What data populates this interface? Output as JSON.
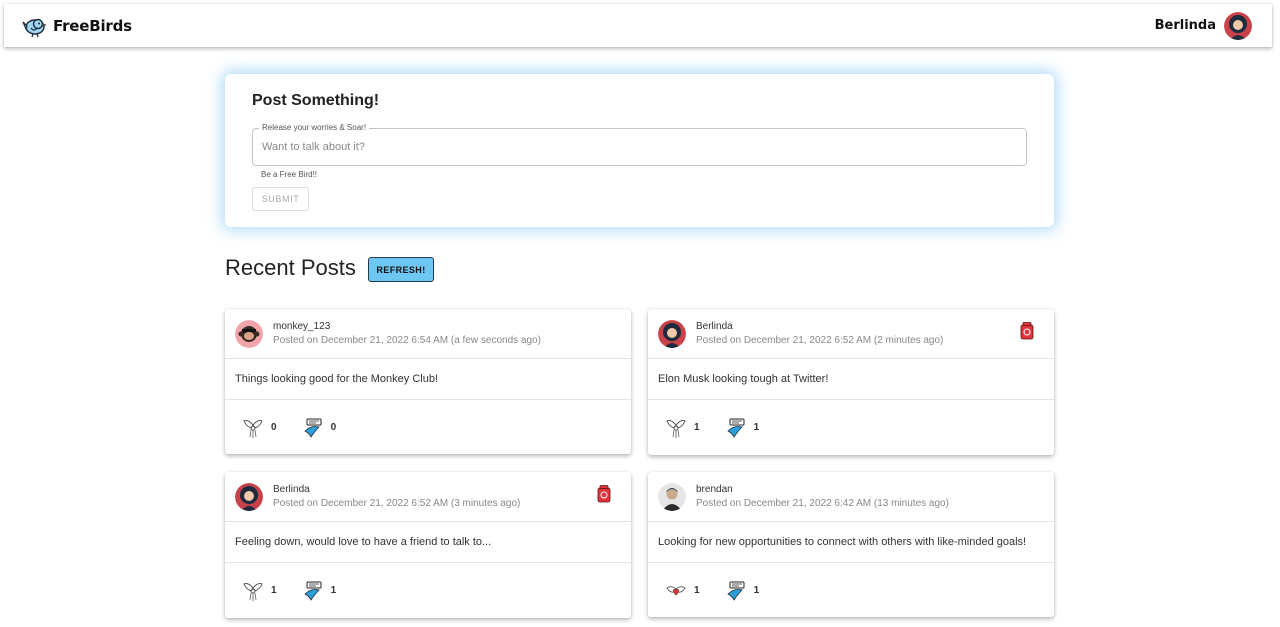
{
  "app": {
    "name": "FreeBirds"
  },
  "header": {
    "username": "Berlinda"
  },
  "composer": {
    "title": "Post Something!",
    "field_label": "Release your worries & Soar!",
    "placeholder": "Want to talk about it?",
    "helper": "Be a Free Bird!!",
    "submit_label": "SUBMIT"
  },
  "feed": {
    "title": "Recent Posts",
    "refresh_label": "REFRESH!",
    "posts": [
      {
        "user": "monkey_123",
        "posted": "Posted on December 21, 2022 6:54 AM (a few seconds ago)",
        "text": "Things looking good for the Monkey Club!",
        "likes": "0",
        "shares": "0",
        "avatar": "monkey",
        "deletable": false
      },
      {
        "user": "Berlinda",
        "posted": "Posted on December 21, 2022 6:52 AM (2 minutes ago)",
        "text": "Elon Musk looking tough at Twitter!",
        "likes": "1",
        "shares": "1",
        "avatar": "berlinda",
        "deletable": true
      },
      {
        "user": "Berlinda",
        "posted": "Posted on December 21, 2022 6:52 AM (3 minutes ago)",
        "text": "Feeling down, would love to have a friend to talk to...",
        "likes": "1",
        "shares": "1",
        "avatar": "berlinda",
        "deletable": true
      },
      {
        "user": "brendan",
        "posted": "Posted on December 21, 2022 6:42 AM (13 minutes ago)",
        "text": "Looking for new opportunities to connect with others with like-minded goals!",
        "likes": "1",
        "shares": "1",
        "avatar": "brendan",
        "deletable": false
      }
    ]
  },
  "colors": {
    "accent": "#6ec6f2",
    "glow": "#78c3f0",
    "delete": "#e0353b",
    "bird": "#2a9fd8"
  }
}
